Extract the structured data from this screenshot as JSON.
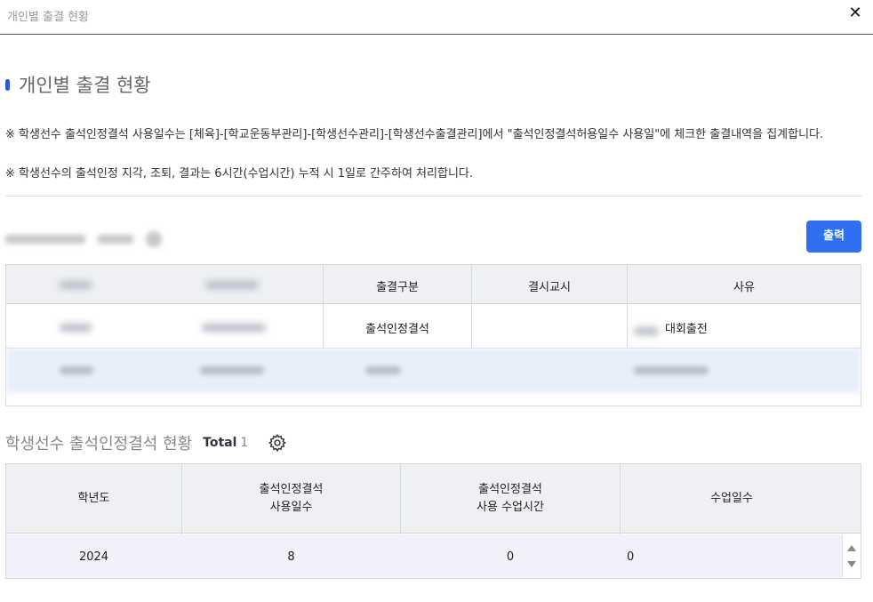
{
  "window": {
    "title": "개인별 출결 현황",
    "close_glyph": "✕"
  },
  "section": {
    "title": "개인별 출결 현황"
  },
  "notices": [
    "※ 학생선수 출석인정결석 사용일수는 [체육]-[학교운동부관리]-[학생선수관리]-[학생선수출결관리]에서 \"출석인정결석허용일수 사용일\"에 체크한 출결내역을 집계합니다.",
    "※ 학생선수의 출석인정 지각, 조퇴, 결과는 6시간(수업시간) 누적 시 1일로 간주하여 처리합니다."
  ],
  "toolbar": {
    "print_label": "출력"
  },
  "attendance_grid": {
    "columns": [
      "",
      "",
      "출결구분",
      "결시교시",
      "사유"
    ],
    "rows": [
      {
        "type": "출석인정결석",
        "period": "",
        "reason": "대회출전"
      }
    ]
  },
  "summary": {
    "title": "학생선수 출석인정결석 현황",
    "total_label": "Total",
    "total_count": "1",
    "columns": [
      {
        "line1": "학년도",
        "line2": ""
      },
      {
        "line1": "출석인정결석",
        "line2": "사용일수"
      },
      {
        "line1": "출석인정결석",
        "line2": "사용 수업시간"
      },
      {
        "line1": "수업일수",
        "line2": ""
      }
    ],
    "rows": [
      {
        "year": "2024",
        "days_used": "8",
        "hours_used": "0",
        "class_days": "0"
      }
    ]
  },
  "colors": {
    "accent": "#2f6ff0",
    "header_bg": "#eef0f4",
    "row_selected": "#f1f1fb"
  }
}
